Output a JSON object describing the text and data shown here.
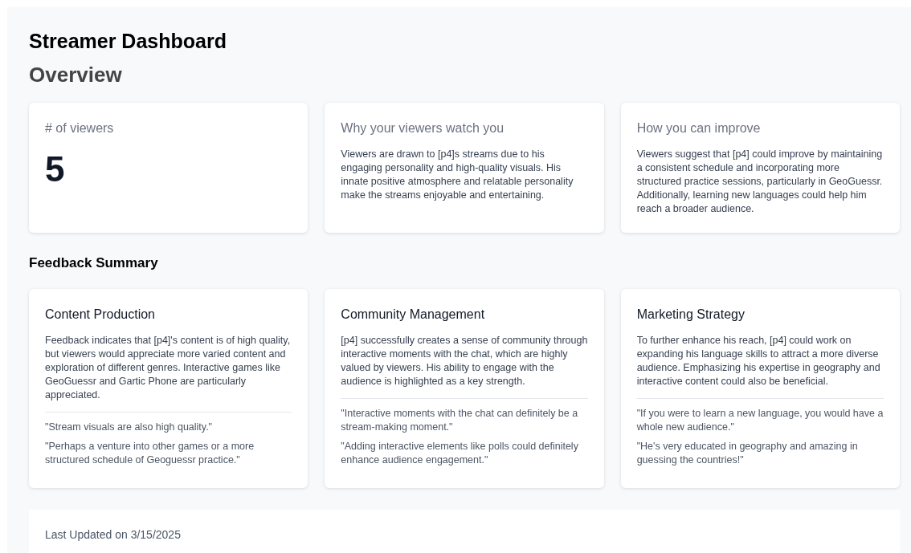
{
  "title": "Streamer Dashboard",
  "overview": {
    "heading": "Overview",
    "cards": [
      {
        "kind": "stat",
        "title": "# of viewers",
        "value": "5"
      },
      {
        "kind": "text",
        "title": "Why your viewers watch you",
        "body": "Viewers are drawn to [p4]s streams due to his engaging personality and high-quality visuals. His innate positive atmosphere and relatable personality make the streams enjoyable and entertaining."
      },
      {
        "kind": "text",
        "title": "How you can improve",
        "body": "Viewers suggest that [p4] could improve by maintaining a consistent schedule and incorporating more structured practice sessions, particularly in GeoGuessr. Additionally, learning new languages could help him reach a broader audience."
      }
    ]
  },
  "feedback": {
    "heading": "Feedback Summary",
    "cards": [
      {
        "title": "Content Production",
        "body": "Feedback indicates that [p4]'s content is of high quality, but viewers would appreciate more varied content and exploration of different genres. Interactive games like GeoGuessr and Gartic Phone are particularly appreciated.",
        "quotes": [
          "\"Stream visuals are also high quality.\"",
          "\"Perhaps a venture into other games or a more structured schedule of Geoguessr practice.\""
        ]
      },
      {
        "title": "Community Management",
        "body": "[p4] successfully creates a sense of community through interactive moments with the chat, which are highly valued by viewers. His ability to engage with the audience is highlighted as a key strength.",
        "quotes": [
          "\"Interactive moments with the chat can definitely be a stream-making moment.\"",
          "\"Adding interactive elements like polls could definitely enhance audience engagement.\""
        ]
      },
      {
        "title": "Marketing Strategy",
        "body": "To further enhance his reach, [p4] could work on expanding his language skills to attract a more diverse audience. Emphasizing his expertise in geography and interactive content could also be beneficial.",
        "quotes": [
          "\"If you were to learn a new language, you would have a whole new audience.\"",
          "\"He's very educated in geography and amazing in guessing the countries!\""
        ]
      }
    ]
  },
  "footer": {
    "last_updated": "Last Updated on 3/15/2025"
  }
}
